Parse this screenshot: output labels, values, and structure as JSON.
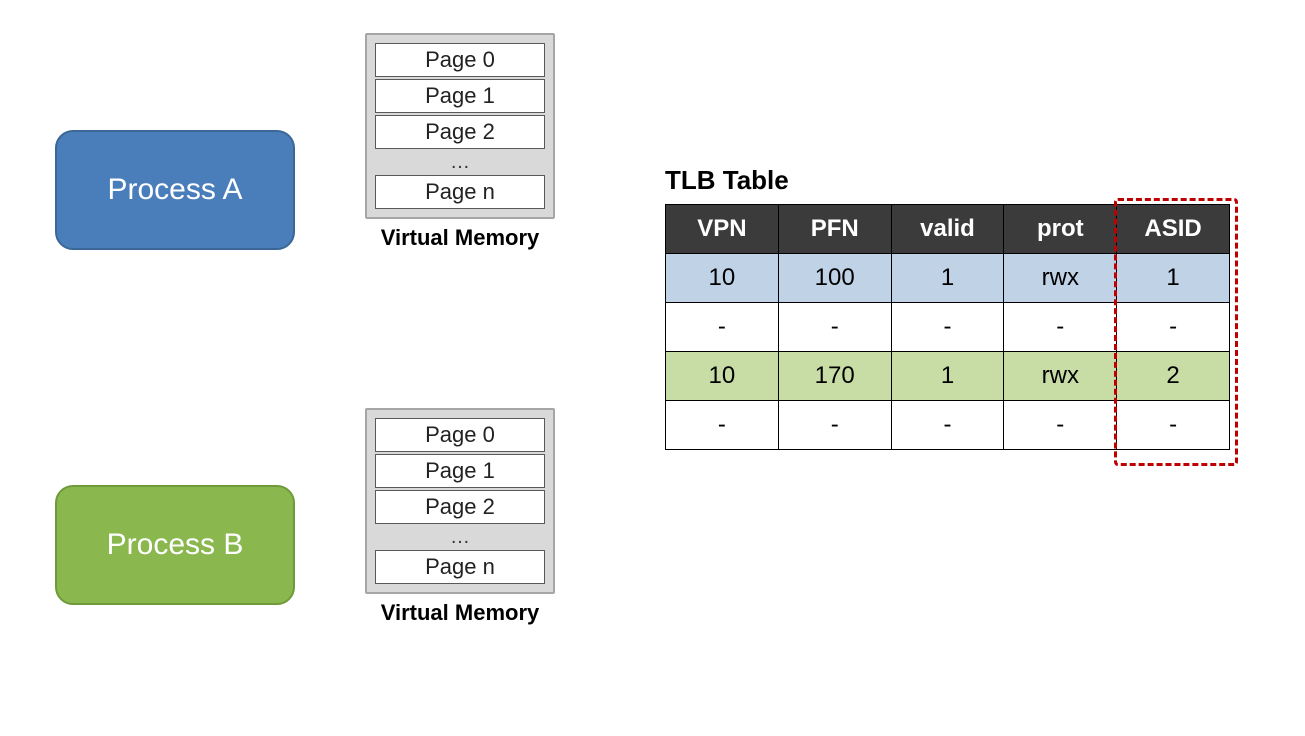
{
  "process_a": {
    "label": "Process A",
    "color": "#4a7ebb"
  },
  "process_b": {
    "label": "Process B",
    "color": "#8ab84e"
  },
  "vm": {
    "caption": "Virtual Memory",
    "pages": [
      "Page 0",
      "Page 1",
      "Page 2"
    ],
    "ellipsis": "…",
    "last": "Page n"
  },
  "tlb": {
    "title": "TLB Table",
    "headers": [
      "VPN",
      "PFN",
      "valid",
      "prot",
      "ASID"
    ],
    "rows": [
      {
        "kind": "blue",
        "cells": [
          "10",
          "100",
          "1",
          "rwx",
          "1"
        ]
      },
      {
        "kind": "empty",
        "cells": [
          "-",
          "-",
          "-",
          "-",
          "-"
        ]
      },
      {
        "kind": "green",
        "cells": [
          "10",
          "170",
          "1",
          "rwx",
          "2"
        ]
      },
      {
        "kind": "empty",
        "cells": [
          "-",
          "-",
          "-",
          "-",
          "-"
        ]
      }
    ],
    "highlight_column": "ASID"
  },
  "chart_data": {
    "type": "table",
    "title": "TLB Table",
    "columns": [
      "VPN",
      "PFN",
      "valid",
      "prot",
      "ASID"
    ],
    "rows": [
      [
        "10",
        "100",
        "1",
        "rwx",
        "1"
      ],
      [
        "-",
        "-",
        "-",
        "-",
        "-"
      ],
      [
        "10",
        "170",
        "1",
        "rwx",
        "2"
      ],
      [
        "-",
        "-",
        "-",
        "-",
        "-"
      ]
    ],
    "row_owner": [
      "Process A",
      null,
      "Process B",
      null
    ],
    "highlighted_column": "ASID"
  }
}
